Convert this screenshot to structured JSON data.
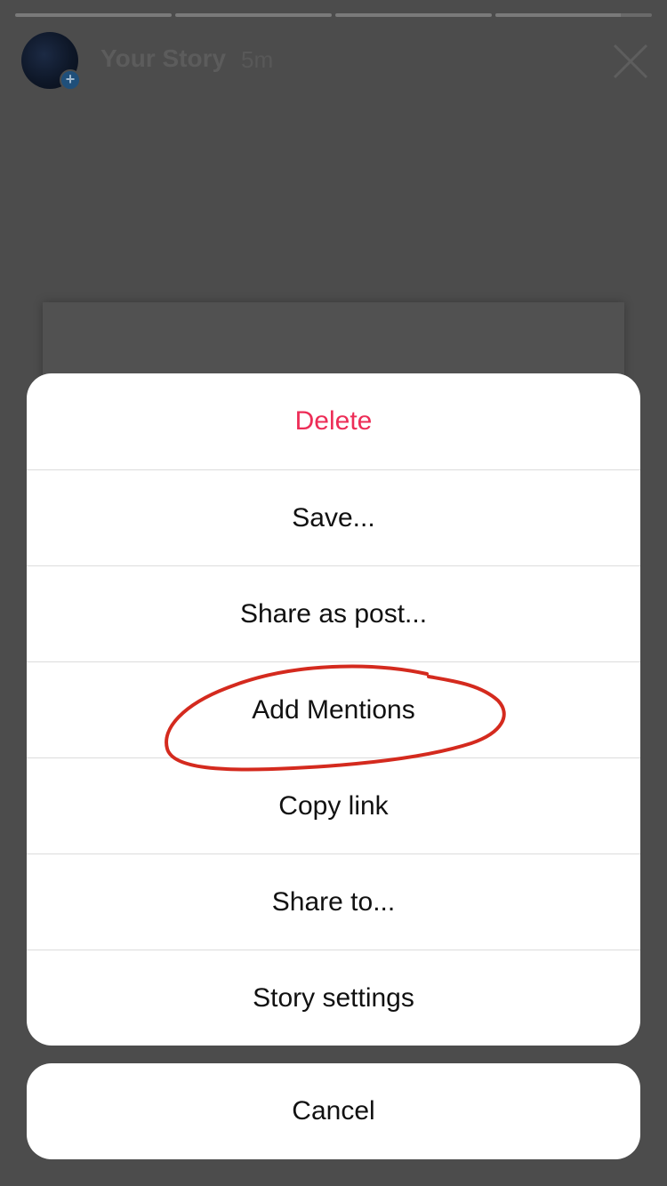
{
  "story": {
    "title": "Your Story",
    "time": "5m",
    "progress_segments": [
      1,
      1,
      1,
      0.8
    ],
    "avatar_badge": "+"
  },
  "icons": {
    "close": "close-icon",
    "add": "plus-icon"
  },
  "action_sheet": {
    "items": [
      {
        "label": "Delete"
      },
      {
        "label": "Save..."
      },
      {
        "label": "Share as post..."
      },
      {
        "label": "Add Mentions"
      },
      {
        "label": "Copy link"
      },
      {
        "label": "Share to..."
      },
      {
        "label": "Story settings"
      }
    ],
    "cancel_label": "Cancel"
  },
  "colors": {
    "delete": "#ed2d57",
    "annotation": "#d42a1e",
    "backdrop": "#4c4c4c"
  }
}
